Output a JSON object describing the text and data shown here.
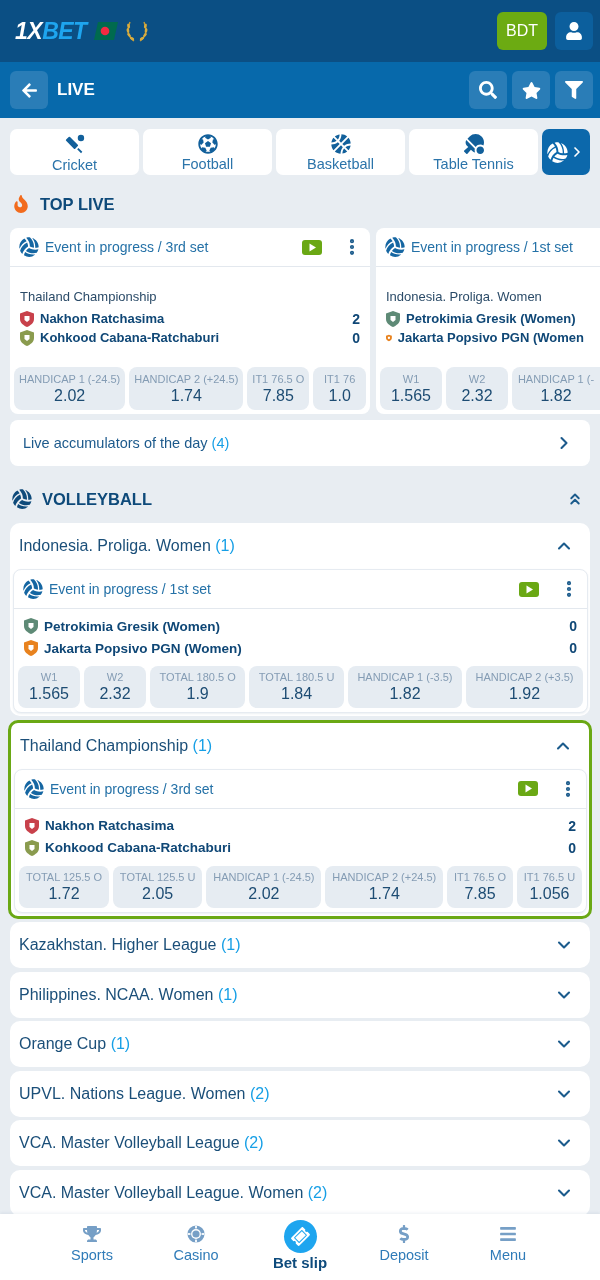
{
  "header": {
    "logo": {
      "lead": "1X",
      "tail": "BET"
    },
    "currency": "BDT"
  },
  "subheader": {
    "title": "LIVE"
  },
  "sport_tabs": [
    {
      "label": "Cricket"
    },
    {
      "label": "Football"
    },
    {
      "label": "Basketball"
    },
    {
      "label": "Table Tennis"
    }
  ],
  "top_live": {
    "title": "TOP LIVE",
    "events": [
      {
        "status": "Event in progress / 3rd set",
        "video": true,
        "menu": true,
        "league": "Thailand Championship",
        "teams": [
          {
            "name": "Nakhon Ratchasima",
            "score": "2",
            "color": "#c8414b"
          },
          {
            "name": "Kohkood Cabana-Ratchaburi",
            "score": "0",
            "color": "#8a9b4e"
          }
        ],
        "odds": [
          {
            "label": "HANDICAP 1 (-24.5)",
            "value": "2.02"
          },
          {
            "label": "HANDICAP 2 (+24.5)",
            "value": "1.74"
          },
          {
            "label": "IT1 76.5 O",
            "value": "7.85"
          },
          {
            "label": "IT1 76",
            "value": "1.0"
          }
        ]
      },
      {
        "status": "Event in progress / 1st set",
        "league": "Indonesia. Proliga. Women",
        "teams": [
          {
            "name": "Petrokimia Gresik (Women)",
            "color": "#5e8a76"
          },
          {
            "name": "Jakarta Popsivo PGN (Women",
            "color": "#e8821e"
          }
        ],
        "odds": [
          {
            "label": "W1",
            "value": "1.565"
          },
          {
            "label": "W2",
            "value": "2.32"
          },
          {
            "label": "HANDICAP 1 (-",
            "value": "1.82"
          }
        ]
      }
    ]
  },
  "accumulators": {
    "label": "Live accumulators of the day",
    "count": "(4)"
  },
  "volleyball": {
    "title": "VOLLEYBALL",
    "leagues": [
      {
        "name": "Indonesia. Proliga. Women",
        "count": "(1)",
        "expanded": true,
        "highlighted": false,
        "event": {
          "status": "Event in progress / 1st set",
          "video": true,
          "menu": true,
          "teams": [
            {
              "name": "Petrokimia Gresik (Women)",
              "score": "0",
              "color": "#5e8a76"
            },
            {
              "name": "Jakarta Popsivo PGN (Women)",
              "score": "0",
              "color": "#e8821e"
            }
          ],
          "odds": [
            {
              "label": "W1",
              "value": "1.565"
            },
            {
              "label": "W2",
              "value": "2.32"
            },
            {
              "label": "TOTAL 180.5 O",
              "value": "1.9"
            },
            {
              "label": "TOTAL 180.5 U",
              "value": "1.84"
            },
            {
              "label": "HANDICAP 1 (-3.5)",
              "value": "1.82"
            },
            {
              "label": "HANDICAP 2 (+3.5)",
              "value": "1.92"
            }
          ]
        }
      },
      {
        "name": "Thailand Championship",
        "count": "(1)",
        "expanded": true,
        "highlighted": true,
        "event": {
          "status": "Event in progress / 3rd set",
          "video": true,
          "menu": true,
          "teams": [
            {
              "name": "Nakhon Ratchasima",
              "score": "2",
              "color": "#c8414b"
            },
            {
              "name": "Kohkood Cabana-Ratchaburi",
              "score": "0",
              "color": "#8a9b4e"
            }
          ],
          "odds": [
            {
              "label": "TOTAL 125.5 O",
              "value": "1.72"
            },
            {
              "label": "TOTAL 125.5 U",
              "value": "2.05"
            },
            {
              "label": "HANDICAP 1 (-24.5)",
              "value": "2.02"
            },
            {
              "label": "HANDICAP 2 (+24.5)",
              "value": "1.74"
            },
            {
              "label": "IT1 76.5 O",
              "value": "7.85"
            },
            {
              "label": "IT1 76.5 U",
              "value": "1.056"
            }
          ]
        }
      },
      {
        "name": "Kazakhstan. Higher League",
        "count": "(1)",
        "expanded": false,
        "highlighted": false
      },
      {
        "name": "Philippines. NCAA. Women",
        "count": "(1)",
        "expanded": false,
        "highlighted": false
      },
      {
        "name": "Orange Cup",
        "count": "(1)",
        "expanded": false,
        "highlighted": false
      },
      {
        "name": "UPVL. Nations League. Women",
        "count": "(2)",
        "expanded": false,
        "highlighted": false
      },
      {
        "name": "VCA. Master Volleyball League",
        "count": "(2)",
        "expanded": false,
        "highlighted": false
      },
      {
        "name": "VCA. Master Volleyball League. Women",
        "count": "(2)",
        "expanded": false,
        "highlighted": false
      }
    ]
  },
  "bottom_nav": [
    {
      "label": "Sports",
      "kind": "regular"
    },
    {
      "label": "Casino",
      "kind": "regular"
    },
    {
      "label": "Bet slip",
      "kind": "primary"
    },
    {
      "label": "Deposit",
      "kind": "regular"
    },
    {
      "label": "Menu",
      "kind": "regular"
    }
  ]
}
